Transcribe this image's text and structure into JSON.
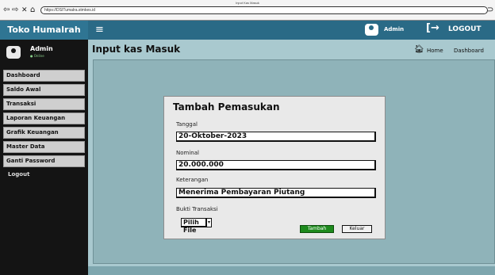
{
  "browser": {
    "window_title": "Input Kas Masuk",
    "url": "https://DSITumalra.stmkes.id"
  },
  "header": {
    "brand": "Toko Humalrah",
    "admin_label": "Admin",
    "logout_label": "LOGOUT"
  },
  "sidebar": {
    "user_name": "Admin",
    "user_status": "● Online",
    "items": [
      {
        "label": "Dashboard"
      },
      {
        "label": "Saldo Awal"
      },
      {
        "label": "Transaksi"
      },
      {
        "label": "Laporan Keuangan"
      },
      {
        "label": "Grafik Keuangan"
      },
      {
        "label": "Master Data"
      },
      {
        "label": "Ganti Password"
      },
      {
        "label": "Logout"
      }
    ]
  },
  "main": {
    "title": "Input kas Masuk",
    "breadcrumb": {
      "home": "Home",
      "current": "Dashboard"
    }
  },
  "form": {
    "title": "Tambah Pemasukan",
    "tanggal_label": "Tanggal",
    "tanggal_value": "20-Oktober-2023",
    "nominal_label": "Nominal",
    "nominal_value": "20.000.000",
    "keterangan_label": "Keterangan",
    "keterangan_value": "Menerima Pembayaran Piutang",
    "bukti_label": "Bukti Transaksi",
    "file_button": "Pilih File",
    "submit_label": "Tambah",
    "cancel_label": "Keluar"
  },
  "icons": {
    "back": "arrow-left-icon",
    "forward": "arrow-right-icon",
    "stop": "close-icon",
    "home": "home-icon",
    "menu": "hamburger-icon",
    "avatar": "user-avatar-icon",
    "logout": "logout-arrow-icon"
  },
  "colors": {
    "header_blue": "#2a6a86",
    "sidebar_black": "#141414",
    "content_teal": "#a9c9cf",
    "submit_green": "#1d8a1d"
  }
}
